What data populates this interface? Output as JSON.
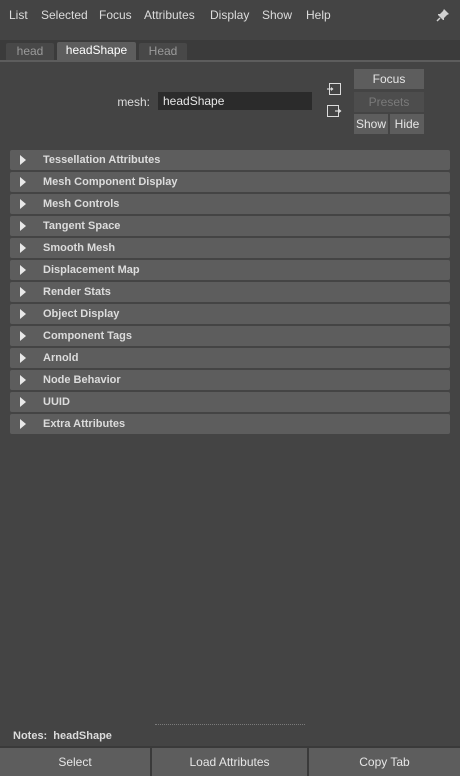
{
  "menubar": {
    "items": [
      "List",
      "Selected",
      "Focus",
      "Attributes",
      "Display",
      "Show",
      "Help"
    ],
    "pin_icon": "pin-icon"
  },
  "tabs": [
    {
      "label": "head",
      "active": false
    },
    {
      "label": "headShape",
      "active": true
    },
    {
      "label": "Head",
      "active": false
    }
  ],
  "node": {
    "type_label": "mesh:",
    "name_value": "headShape",
    "icons": [
      "input-connections-icon",
      "output-connections-icon"
    ]
  },
  "side_buttons": {
    "focus": "Focus",
    "presets": "Presets",
    "show": "Show",
    "hide": "Hide"
  },
  "sections": [
    "Tessellation Attributes",
    "Mesh Component Display",
    "Mesh Controls",
    "Tangent Space",
    "Smooth Mesh",
    "Displacement Map",
    "Render Stats",
    "Object Display",
    "Component Tags",
    "Arnold",
    "Node Behavior",
    "UUID",
    "Extra Attributes"
  ],
  "notes": {
    "label": "Notes:",
    "value": "headShape"
  },
  "bottom_buttons": {
    "select": "Select",
    "load_attributes": "Load Attributes",
    "copy_tab": "Copy Tab"
  },
  "colors": {
    "background": "#444444",
    "panel": "#5d5d5d",
    "field": "#2b2b2b",
    "text": "#dcdcdc"
  }
}
